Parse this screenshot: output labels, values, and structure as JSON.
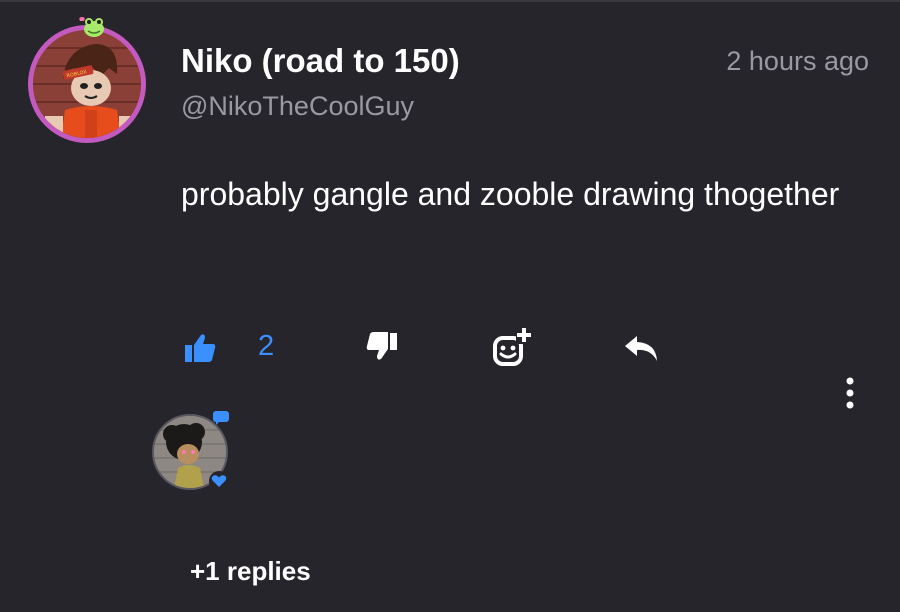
{
  "comment": {
    "author_name": "Niko (road to 150)",
    "author_handle": "@NikoTheCoolGuy",
    "timestamp": "2 hours ago",
    "body": "probably gangle and zooble drawing thogether",
    "avatar_shirt_text": "ROBLOX"
  },
  "actions": {
    "like_count": "2",
    "like_icon": "thumbs-up-icon",
    "dislike_icon": "thumbs-down-icon",
    "react_icon": "add-reaction-icon",
    "reply_icon": "reply-arrow-icon",
    "more_icon": "vertical-ellipsis-icon"
  },
  "replies": {
    "link_label": "+1 replies"
  },
  "colors": {
    "background": "#26252b",
    "accent_blue": "#3b8fff",
    "muted_text": "#9a99a3",
    "avatar_ring": "#c35abf",
    "badge_green": "#a8e86a"
  }
}
